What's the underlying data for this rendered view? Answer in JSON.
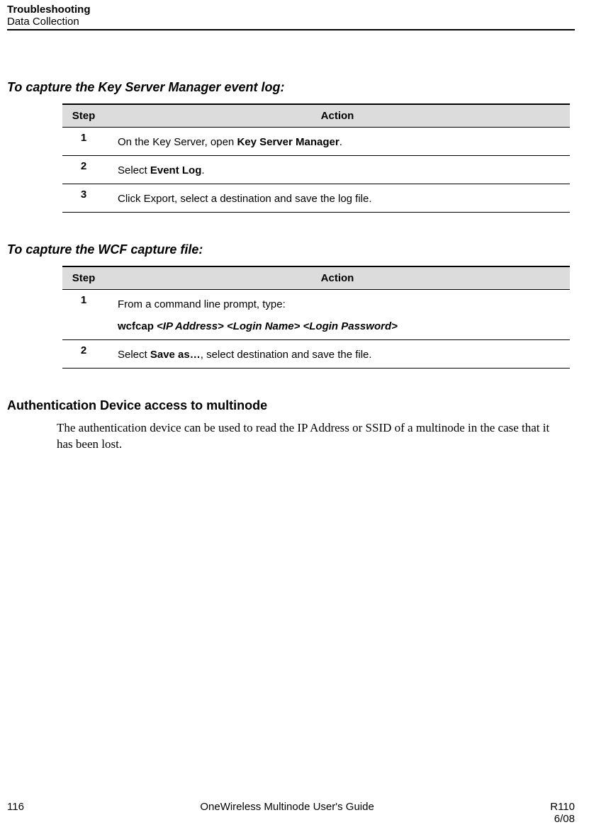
{
  "header": {
    "title": "Troubleshooting",
    "subtitle": "Data Collection"
  },
  "section1": {
    "title": "To capture the Key Server Manager event log:",
    "col_step": "Step",
    "col_action": "Action",
    "rows": [
      {
        "num": "1",
        "pre": "On the Key Server, open ",
        "bold": "Key Server Manager",
        "post": "."
      },
      {
        "num": "2",
        "pre": "Select ",
        "bold": "Event Log",
        "post": "."
      },
      {
        "num": "3",
        "pre": "Click Export, select a destination and save the log file.",
        "bold": "",
        "post": ""
      }
    ]
  },
  "section2": {
    "title": "To capture the WCF capture file:",
    "col_step": "Step",
    "col_action": "Action",
    "rows": [
      {
        "num": "1",
        "line1": "From a command line prompt, type:",
        "cmd_prefix": "wcfcap ",
        "cmd_args": "<IP Address> <Login Name> <Login Password>"
      },
      {
        "num": "2",
        "pre": "Select ",
        "bold": "Save as…",
        "post": ", select destination and save the file."
      }
    ]
  },
  "subhead": "Authentication Device access to multinode",
  "body": "The authentication device can be used to read the IP Address or SSID of a multinode in the case that it has been lost.",
  "footer": {
    "page": "116",
    "center": "OneWireless Multinode User's Guide",
    "rev": "R110",
    "date": "6/08"
  }
}
